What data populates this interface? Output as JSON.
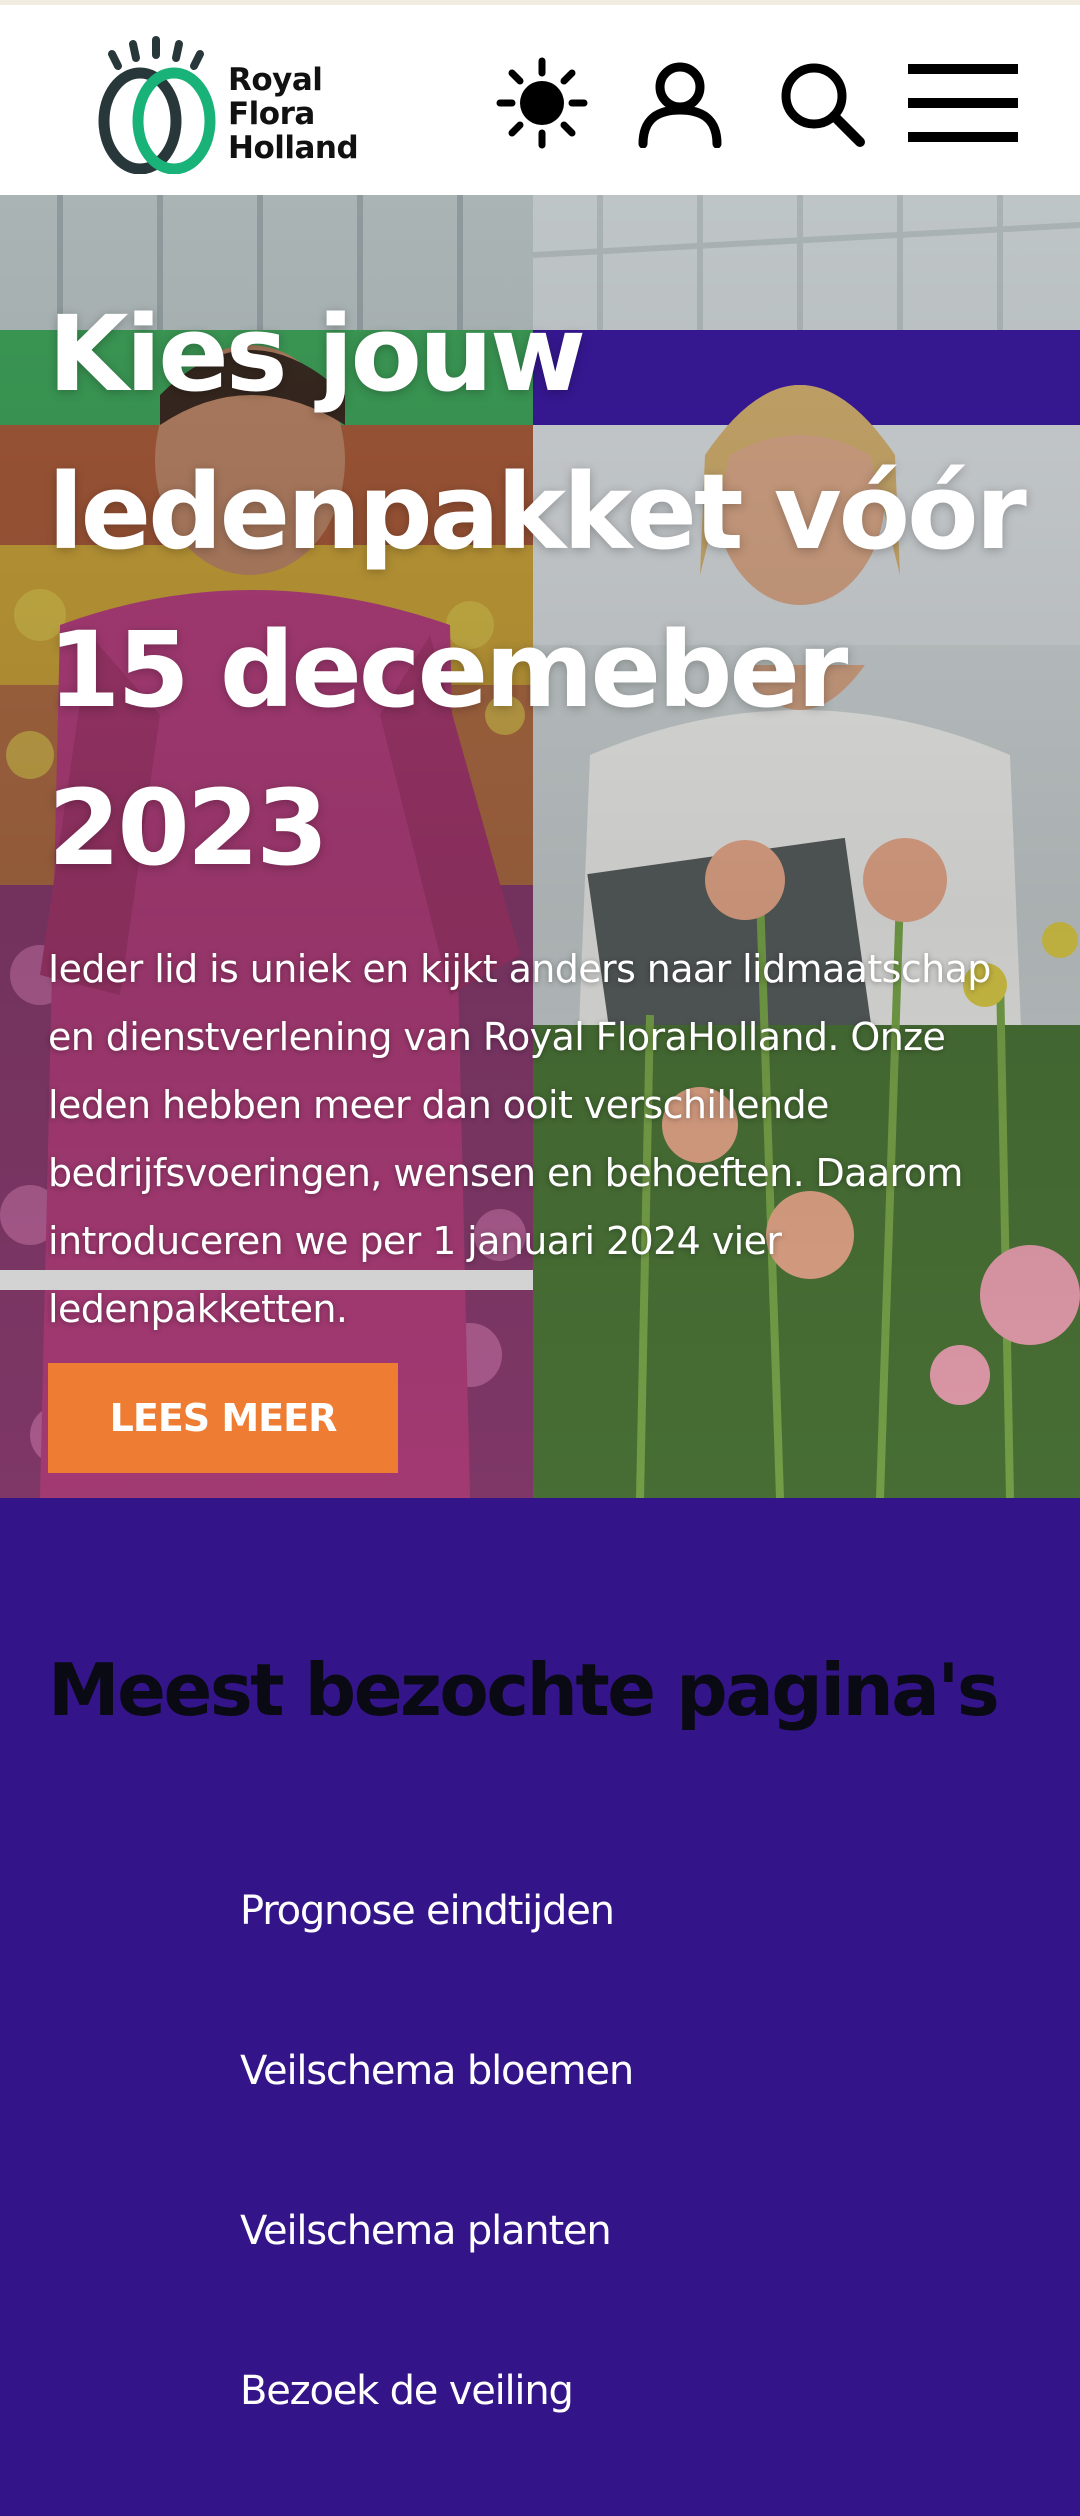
{
  "header": {
    "logo": {
      "line1": "Royal",
      "line2": "Flora",
      "line3": "Holland",
      "colors": {
        "green": "#19b37a",
        "dark": "#28383a"
      }
    },
    "icons": {
      "theme": "sun-icon",
      "account": "user-icon",
      "search": "search-icon",
      "menu": "menu-icon"
    }
  },
  "hero": {
    "title": "Kies jouw ledenpakket vóór 15 decemeber 2023",
    "text": "Ieder lid is uniek en kijkt anders naar lidmaatschap en dienstverlening van Royal FloraHolland. Onze leden hebben meer dan ooit verschillende bedrijfsvoeringen, wensen en behoeften. Daarom introduceren we per 1 januari 2024 vier ledenpakketten.",
    "button_label": "LEES MEER",
    "button_color": "#ee7c32"
  },
  "popular": {
    "title": "Meest bezochte pagina's",
    "background": "#341489",
    "links": [
      {
        "label": "Prognose eindtijden"
      },
      {
        "label": "Veilschema bloemen"
      },
      {
        "label": "Veilschema planten"
      },
      {
        "label": "Bezoek de veiling"
      }
    ]
  }
}
